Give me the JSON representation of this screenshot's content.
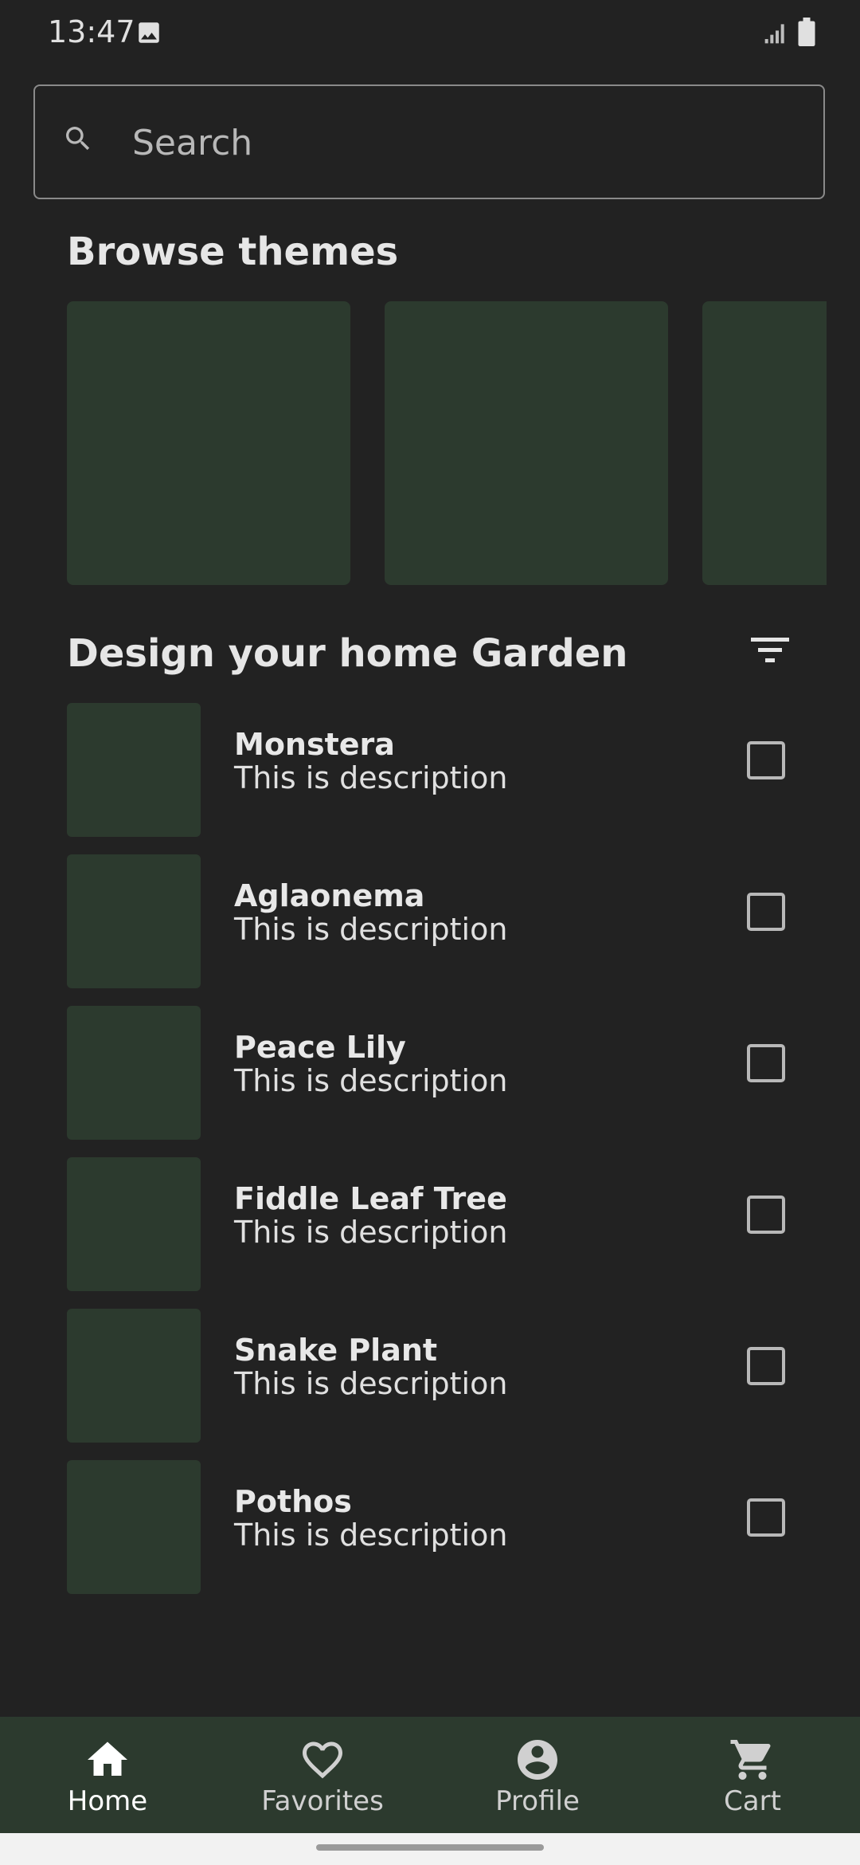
{
  "status_bar": {
    "time": "13:47"
  },
  "search": {
    "placeholder": "Search",
    "value": ""
  },
  "themes_section": {
    "title": "Browse themes",
    "cards": [
      {},
      {},
      {}
    ]
  },
  "garden_section": {
    "title": "Design your home Garden"
  },
  "plants": [
    {
      "name": "Monstera",
      "description": "This is description",
      "checked": false
    },
    {
      "name": "Aglaonema",
      "description": "This is description",
      "checked": false
    },
    {
      "name": "Peace Lily",
      "description": "This is description",
      "checked": false
    },
    {
      "name": "Fiddle Leaf Tree",
      "description": "This is description",
      "checked": false
    },
    {
      "name": "Snake Plant",
      "description": "This is description",
      "checked": false
    },
    {
      "name": "Pothos",
      "description": "This is description",
      "checked": false
    }
  ],
  "bottom_nav": [
    {
      "label": "Home",
      "icon": "home-icon",
      "active": true
    },
    {
      "label": "Favorites",
      "icon": "heart-icon",
      "active": false
    },
    {
      "label": "Profile",
      "icon": "account-circle-icon",
      "active": false
    },
    {
      "label": "Cart",
      "icon": "cart-icon",
      "active": false
    }
  ],
  "colors": {
    "background": "#222222",
    "surface_green": "#2c3a2e",
    "text": "#e6e6e6"
  }
}
